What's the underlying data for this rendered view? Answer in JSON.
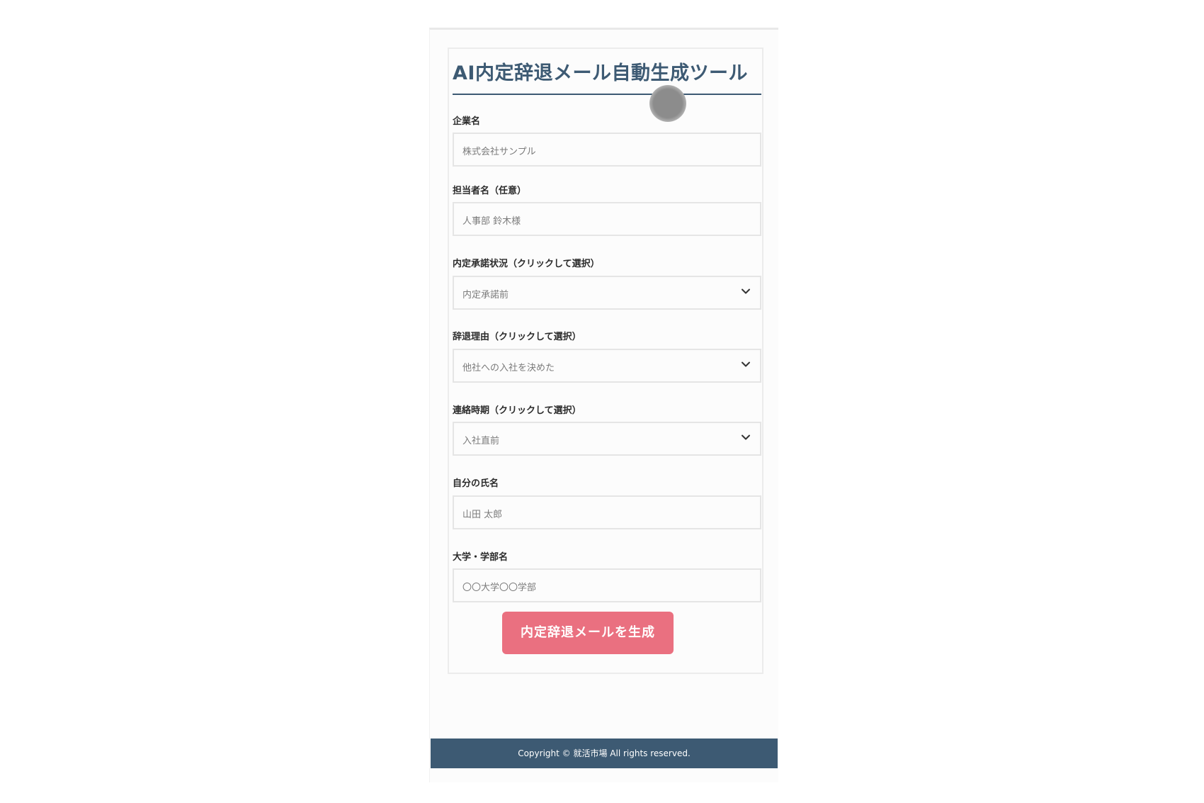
{
  "page": {
    "title": "AI内定辞退メール自動生成ツール"
  },
  "form": {
    "company": {
      "label": "企業名",
      "placeholder": "株式会社サンプル"
    },
    "contact": {
      "label": "担当者名（任意）",
      "placeholder": "人事部 鈴木様"
    },
    "status": {
      "label": "内定承諾状況（クリックして選択）",
      "value": "内定承諾前"
    },
    "reason": {
      "label": "辞退理由（クリックして選択）",
      "value": "他社への入社を決めた"
    },
    "timing": {
      "label": "連絡時期（クリックして選択）",
      "value": "入社直前"
    },
    "name": {
      "label": "自分の氏名",
      "placeholder": "山田 太郎"
    },
    "university": {
      "label": "大学・学部名",
      "placeholder": "〇〇大学〇〇学部"
    },
    "submit_label": "内定辞退メールを生成"
  },
  "footer": {
    "copyright": "Copyright © 就活市場 All rights reserved."
  },
  "icons": {
    "dropdown": "chevron-down-icon",
    "pointer": "touch-pointer-icon"
  },
  "colors": {
    "primary": "#3d5a73",
    "button": "#ea7080",
    "border": "#e5e5e5"
  }
}
